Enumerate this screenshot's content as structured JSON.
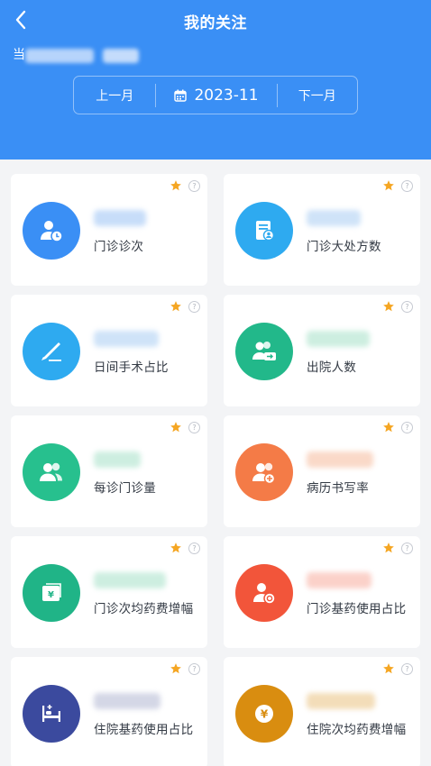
{
  "header": {
    "title": "我的关注",
    "sub_prefix": "当",
    "prev_month": "上一月",
    "current_month": "2023-11",
    "next_month": "下一月"
  },
  "colors": {
    "header_bg": "#3a8ff5",
    "star": "#f5a623"
  },
  "cards": [
    {
      "label": "门诊诊次",
      "icon": "person-clock-icon",
      "color": "#3a8ff5"
    },
    {
      "label": "门诊大处方数",
      "icon": "prescription-icon",
      "color": "#2eaaf0"
    },
    {
      "label": "日间手术占比",
      "icon": "scalpel-icon",
      "color": "#2eaaf0"
    },
    {
      "label": "出院人数",
      "icon": "people-exit-icon",
      "color": "#22b88a"
    },
    {
      "label": "每诊门诊量",
      "icon": "people-icon",
      "color": "#27c08e"
    },
    {
      "label": "病历书写率",
      "icon": "medical-people-icon",
      "color": "#f47b47"
    },
    {
      "label": "门诊次均药费增幅",
      "icon": "yuan-card-icon",
      "color": "#20b487"
    },
    {
      "label": "门诊基药使用占比",
      "icon": "person-coin-icon",
      "color": "#f2553a"
    },
    {
      "label": "住院基药使用占比",
      "icon": "hospital-bed-icon",
      "color": "#3b4a9e"
    },
    {
      "label": "住院次均药费增幅",
      "icon": "yuan-coin-icon",
      "color": "#d98d10"
    }
  ]
}
